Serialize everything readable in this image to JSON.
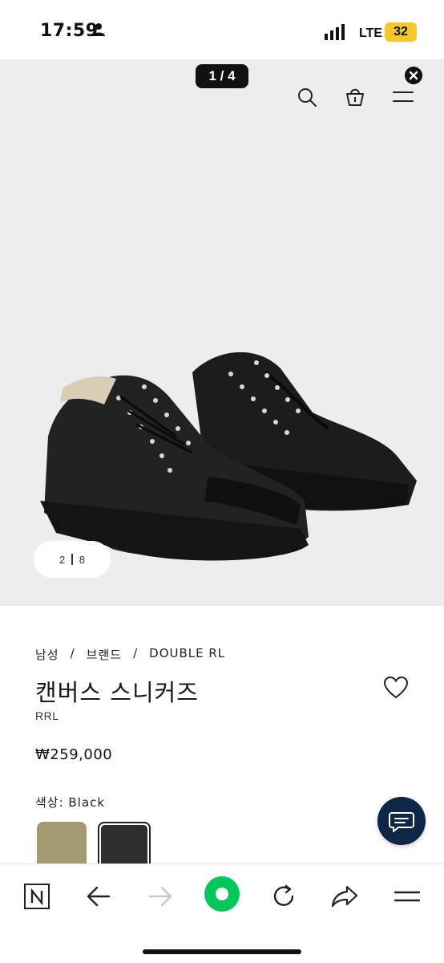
{
  "status_bar": {
    "time": "17:59",
    "network": "LTE",
    "battery": "32"
  },
  "gallery": {
    "counter": "1 / 4",
    "thumb_index": "2",
    "thumb_total": "8"
  },
  "header_icons": [
    "search-icon",
    "shopping-bag-icon",
    "menu-icon",
    "close-icon"
  ],
  "breadcrumb": [
    "남성",
    "/",
    "브랜드",
    "/",
    "DOUBLE RL"
  ],
  "product": {
    "title": "캔버스 스니커즈",
    "brand": "RRL",
    "price": "₩259,000",
    "color_label": "색상: Black",
    "swatches": [
      {
        "name": "tan",
        "color": "#a49a72"
      },
      {
        "name": "black",
        "color": "#2e2e2e"
      }
    ]
  },
  "toolbar": {
    "items": [
      "naver-n-icon",
      "back-arrow-icon",
      "forward-arrow-icon",
      "green-dot-icon",
      "reload-icon",
      "share-icon",
      "menu-icon"
    ],
    "accent": "#03c75a",
    "naver_letter": "N"
  },
  "colors": {
    "chat_button": "#0f2747",
    "hero_background": "#eeeded"
  }
}
